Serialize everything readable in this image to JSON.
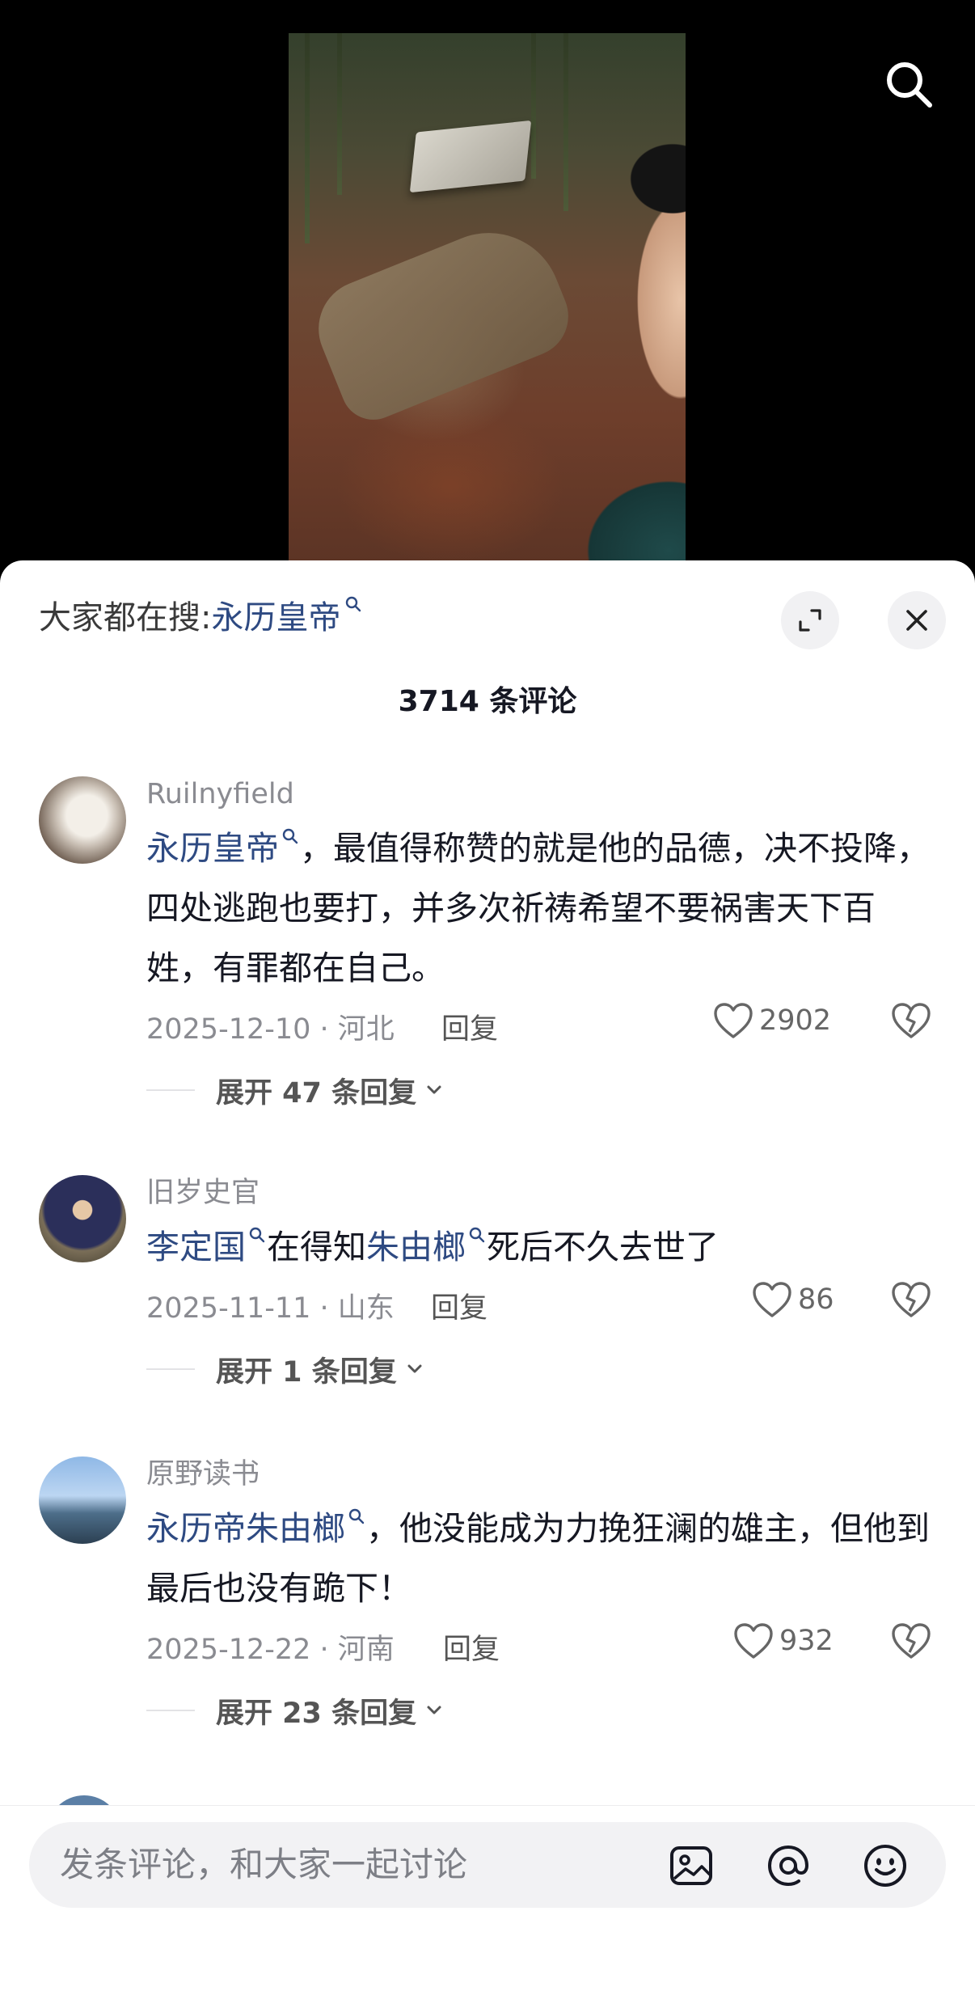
{
  "hot_search": {
    "label": "大家都在搜:",
    "term": "永历皇帝"
  },
  "comment_count": "3714 条评论",
  "comments": [
    {
      "username": "Ruilnyfield",
      "keyword": "永历皇帝",
      "text_after": "，最值得称赞的就是他的品德，决不投降，四处逃跑也要打，并多次祈祷希望不要祸害天下百姓，有罪都在自己。",
      "date_location": "2025-12-10 · 河北",
      "reply_label": "回复",
      "likes": "2902",
      "expand_label": "展开 47 条回复"
    },
    {
      "username": "旧岁史官",
      "keyword": "李定国",
      "text_mid": "在得知",
      "keyword2": "朱由榔",
      "text_after": "死后不久去世了",
      "date_location": "2025-11-11 · 山东",
      "reply_label": "回复",
      "likes": "86",
      "expand_label": "展开 1 条回复"
    },
    {
      "username": "原野读书",
      "keyword": "永历帝朱由榔",
      "text_after": "，他没能成为力挽狂澜的雄主，但他到最后也没有跪下！",
      "date_location": "2025-12-22 · 河南",
      "reply_label": "回复",
      "likes": "932",
      "expand_label": "展开 23 条回复"
    }
  ],
  "input": {
    "placeholder": "发条评论，和大家一起讨论"
  },
  "icons": {
    "top_search": "search-icon",
    "expand": "expand-icon",
    "close": "close-icon",
    "like": "heart-icon",
    "dislike": "broken-heart-icon",
    "image": "image-icon",
    "mention": "at-icon",
    "emoji": "emoji-icon"
  },
  "colors": {
    "keyword_link": "#2e4a82",
    "secondary_text": "#8a8b91",
    "sheet_bg": "#ffffff",
    "video_bg": "#000000"
  }
}
